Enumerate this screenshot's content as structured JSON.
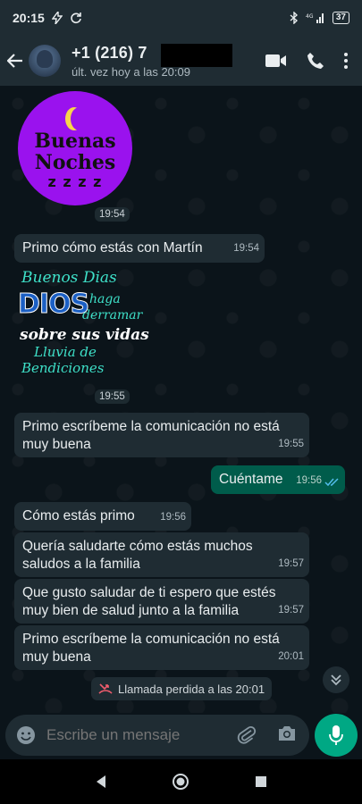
{
  "status_bar": {
    "time": "20:15",
    "network": "4G",
    "battery": "37"
  },
  "header": {
    "contact_name": "+1 (216) 7",
    "last_seen": "últ. vez hoy a las 20:09"
  },
  "messages": [
    {
      "type": "sticker",
      "direction": "in",
      "sticker_text": [
        "Buenas",
        "Noches",
        "z z z z"
      ],
      "time": "19:54"
    },
    {
      "type": "text",
      "direction": "in",
      "text": "Primo cómo estás con Martín",
      "time": "19:54"
    },
    {
      "type": "sticker",
      "direction": "in",
      "sticker_text": [
        "Buenos Dias",
        "DIOS",
        "haga",
        "derramar",
        "sobre sus vidas",
        "Lluvia de",
        "Bendiciones"
      ],
      "time": "19:55"
    },
    {
      "type": "text",
      "direction": "in",
      "text_lines": [
        "Primo escríbeme la comunicación no está",
        "muy buena"
      ],
      "time": "19:55"
    },
    {
      "type": "text",
      "direction": "out",
      "text": "Cuéntame",
      "time": "19:56",
      "status": "read"
    },
    {
      "type": "text",
      "direction": "in",
      "text": "Cómo estás primo",
      "time": "19:56"
    },
    {
      "type": "text",
      "direction": "in",
      "text_lines": [
        "Quería saludarte cómo estás muchos",
        "saludos a la familia"
      ],
      "time": "19:57"
    },
    {
      "type": "text",
      "direction": "in",
      "text_lines": [
        "Que gusto saludar de ti espero que estés",
        "muy bien de salud junto a la familia"
      ],
      "time": "19:57"
    },
    {
      "type": "text",
      "direction": "in",
      "text_lines": [
        "Primo escríbeme la comunicación no está",
        "muy buena"
      ],
      "time": "20:01"
    }
  ],
  "missed_call": "Llamada perdida a las 20:01",
  "input": {
    "placeholder": "Escribe un mensaje"
  },
  "colors": {
    "header_bg": "#1f2c33",
    "chat_bg": "#0b141a",
    "incoming": "#1f2c33",
    "outgoing": "#005c4b",
    "accent": "#00a884",
    "read_ticks": "#53bdeb",
    "missed_icon": "#f15c6d"
  }
}
